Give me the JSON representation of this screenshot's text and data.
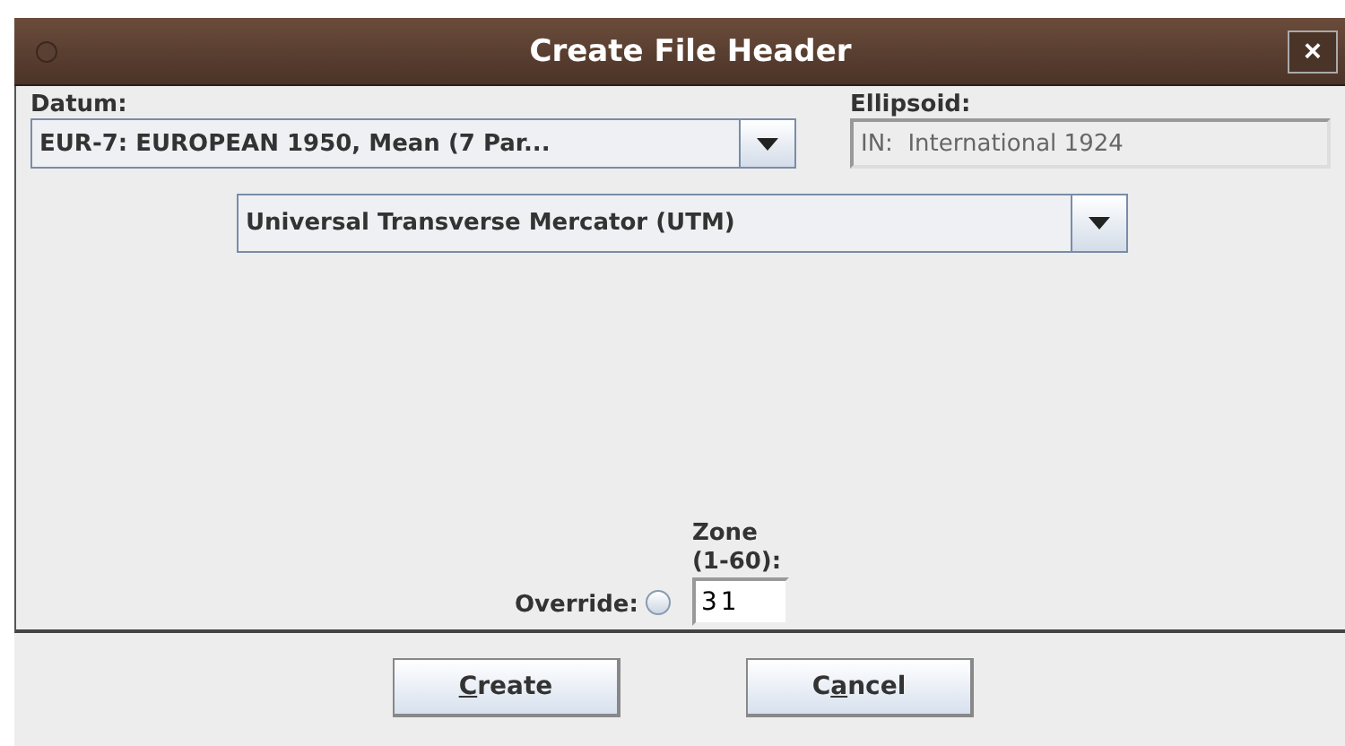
{
  "window": {
    "title": "Create File Header",
    "close_glyph": "×"
  },
  "datum": {
    "label": "Datum:",
    "value": "EUR-7:  EUROPEAN 1950, Mean (7 Par..."
  },
  "ellipsoid": {
    "label": "Ellipsoid:",
    "value": "IN:  International 1924",
    "disabled": true
  },
  "projection": {
    "value": "Universal Transverse Mercator (UTM)"
  },
  "override": {
    "label": "Override:",
    "checked": false
  },
  "zone": {
    "label": "Zone (1-60):",
    "value": "31"
  },
  "buttons": [
    {
      "key": "C",
      "after": "reate"
    },
    {
      "before": "C",
      "key": "a",
      "after": "ncel"
    }
  ]
}
